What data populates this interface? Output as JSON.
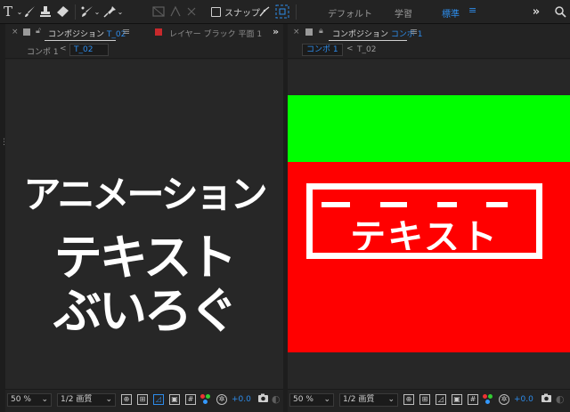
{
  "toolbar": {
    "tools": [
      "T-icon",
      "brush-icon",
      "stamp-icon",
      "eraser-icon",
      "roto-brush-icon",
      "puppet-pin-icon"
    ],
    "snap_label": "スナップ",
    "workspaces": [
      "デフォルト",
      "学習",
      "標準"
    ],
    "active_workspace": "標準",
    "menu_glyph": "≡",
    "more_glyph": "»"
  },
  "left_panel": {
    "tab_close": "×",
    "tab1_prefix": "コンポジション ",
    "tab1_comp": "T_02",
    "tab_menu": "≡",
    "tab2_title": "レイヤー ブラック 平面 1",
    "more": "»",
    "breadcrumb": [
      "コンポ 1",
      "T_02"
    ],
    "crumb_arrow": "<",
    "viewer_lines": [
      "アニメーション",
      "テキスト",
      "ぶいろぐ"
    ],
    "footer": {
      "zoom": "50 %",
      "resolution": "1/2 画質",
      "exposure": "+0.0"
    }
  },
  "right_panel": {
    "tab_close": "×",
    "tab_prefix": "コンポジション ",
    "tab_comp": "コンポ 1",
    "tab_menu": "≡",
    "breadcrumb": [
      "コンポ 1",
      "T_02"
    ],
    "crumb_arrow": "<",
    "comp_text": "テキスト",
    "footer": {
      "zoom": "50 %",
      "resolution": "1/2 画質",
      "exposure": "+0.0"
    }
  },
  "colors": {
    "accent": "#2d8ceb",
    "comp_green": "#00ff00",
    "comp_red": "#ff0000",
    "solid_tab_swatch": "#c8292c"
  }
}
